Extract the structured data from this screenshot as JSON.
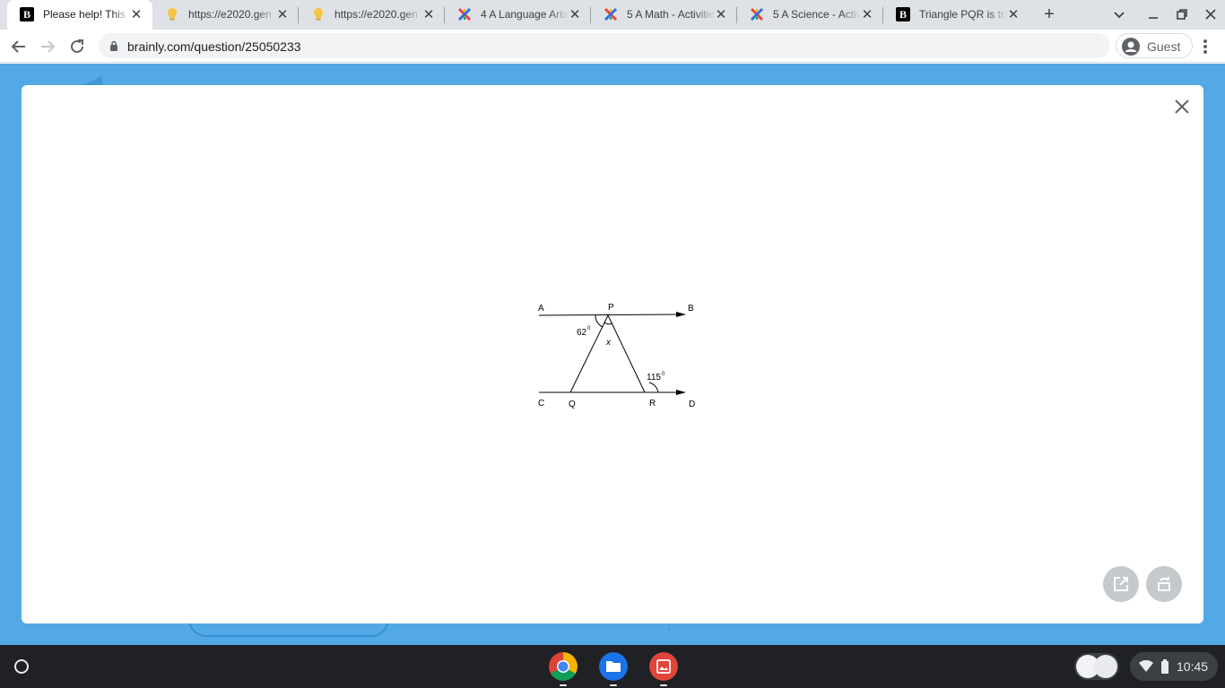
{
  "browser": {
    "tabs": [
      {
        "title": "Please help! This is",
        "favicon": "brainly-icon",
        "active": true
      },
      {
        "title": "https://e2020.gen",
        "favicon": "lightbulb-icon",
        "active": false
      },
      {
        "title": "https://e2020.gen",
        "favicon": "lightbulb-icon",
        "active": false
      },
      {
        "title": "4 A Language Arts",
        "favicon": "colorful-x-icon",
        "active": false
      },
      {
        "title": "5 A Math - Activitie",
        "favicon": "colorful-x-icon",
        "active": false
      },
      {
        "title": "5 A Science - Activi",
        "favicon": "colorful-x-icon",
        "active": false
      },
      {
        "title": "Triangle PQR is tra",
        "favicon": "brainly-icon",
        "active": false
      }
    ],
    "brainly_glyph": "B",
    "url": "brainly.com/question/25050233",
    "profile_label": "Guest"
  },
  "diagram": {
    "points": {
      "A": "A",
      "P": "P",
      "B": "B",
      "C": "C",
      "Q": "Q",
      "R": "R",
      "D": "D"
    },
    "angles": {
      "at_p_left": "62",
      "at_p_unknown": "x",
      "at_r_exterior": "115"
    },
    "degree_symbol": "0"
  },
  "shelf": {
    "apps": [
      "chrome-icon",
      "files-icon",
      "gallery-icon"
    ],
    "time": "10:45"
  },
  "colors": {
    "page_background": "#53a9e6",
    "tabstrip": "#dee1e6",
    "shelf": "#202124"
  }
}
